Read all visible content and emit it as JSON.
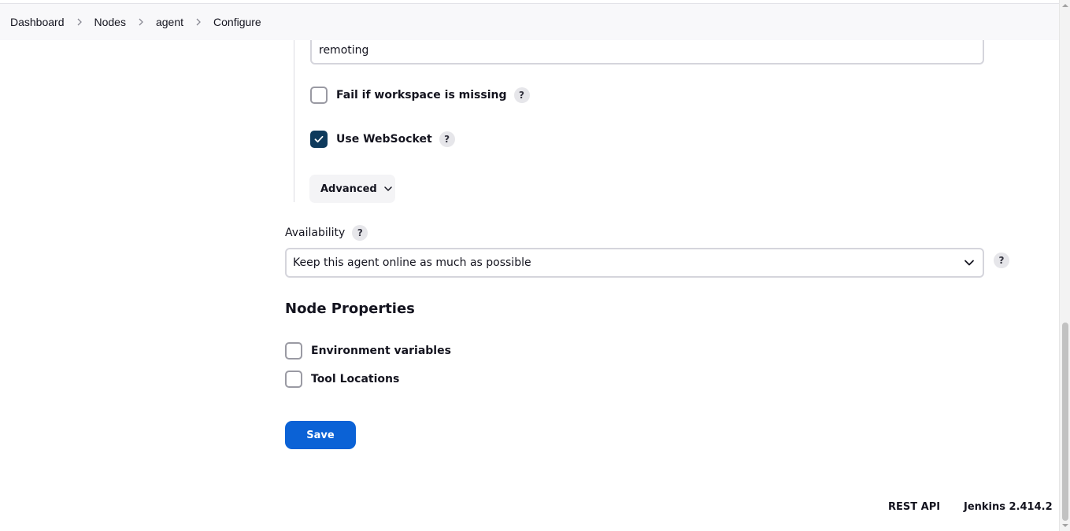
{
  "breadcrumb": {
    "items": [
      {
        "label": "Dashboard"
      },
      {
        "label": "Nodes"
      },
      {
        "label": "agent"
      },
      {
        "label": "Configure"
      }
    ]
  },
  "launch": {
    "remote_root_value": "remoting",
    "fail_if_workspace_missing": {
      "label": "Fail if workspace is missing",
      "checked": false
    },
    "use_websocket": {
      "label": "Use WebSocket",
      "checked": true
    },
    "advanced_label": "Advanced"
  },
  "availability": {
    "label": "Availability",
    "selected": "Keep this agent online as much as possible"
  },
  "node_properties": {
    "heading": "Node Properties",
    "items": [
      {
        "label": "Environment variables",
        "checked": false
      },
      {
        "label": "Tool Locations",
        "checked": false
      }
    ]
  },
  "help_glyph": "?",
  "save_label": "Save",
  "footer": {
    "rest_api": "REST API",
    "version": "Jenkins 2.414.2"
  },
  "colors": {
    "primary_button": "#0b62d6",
    "checkbox_checked": "#0e3a5c"
  },
  "icons": {
    "breadcrumb_separator": "chevron-right-icon",
    "advanced": "chevron-down-icon",
    "select": "chevron-down-icon",
    "checkbox": "checkmark-icon"
  }
}
